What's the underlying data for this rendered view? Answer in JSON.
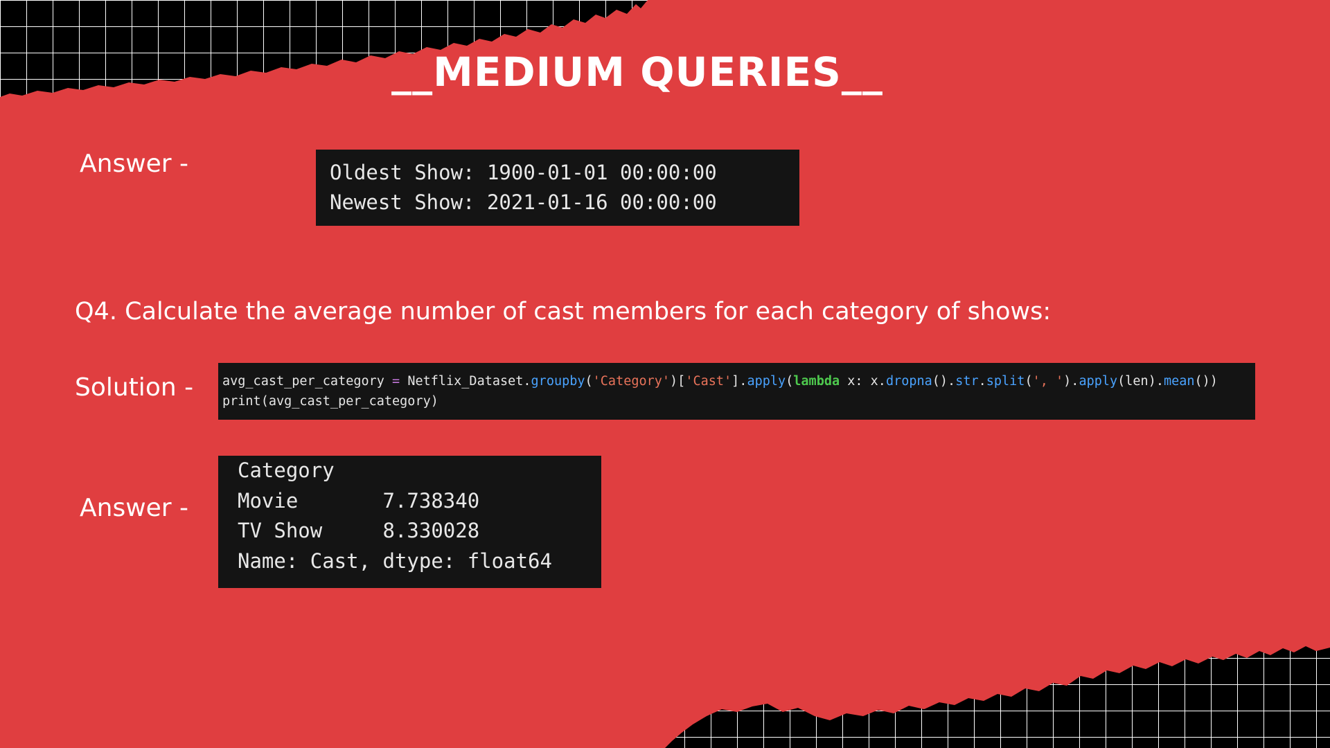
{
  "page": {
    "title": "__MEDIUM QUERIES__",
    "colors": {
      "background": "#e03e40",
      "torn_pattern": "#000000",
      "grid_lines": "#ffffff",
      "terminal": "#141414",
      "text": "#ffffff"
    }
  },
  "section1": {
    "answer_label": "Answer -",
    "output": [
      "Oldest Show: 1900-01-01 00:00:00",
      "Newest Show: 2021-01-16 00:00:00"
    ]
  },
  "section2": {
    "question": "Q4. Calculate the average number of cast members for each category of shows:",
    "solution_label": "Solution -",
    "code": {
      "line1": {
        "var": "avg_cast_per_category ",
        "op": "=",
        "obj": " Netflix_Dataset.",
        "groupby": "groupby",
        "p1": "(",
        "s1": "'Category'",
        "p2": ")[",
        "s2": "'Cast'",
        "p3": "].",
        "apply": "apply",
        "p4": "(",
        "lambda": "lambda",
        "x": " x: x.",
        "dropna": "dropna",
        "p5": "().",
        "str": "str",
        "p6": ".",
        "split": "split",
        "p7": "(",
        "s3": "', '",
        "p8": ").",
        "apply2": "apply",
        "p9": "(len).",
        "mean": "mean",
        "p10": "())"
      },
      "line2": "print(avg_cast_per_category)"
    },
    "answer_label": "Answer -",
    "output": [
      "Category",
      "Movie       7.738340",
      "TV Show     8.330028",
      "Name: Cast, dtype: float64"
    ]
  }
}
